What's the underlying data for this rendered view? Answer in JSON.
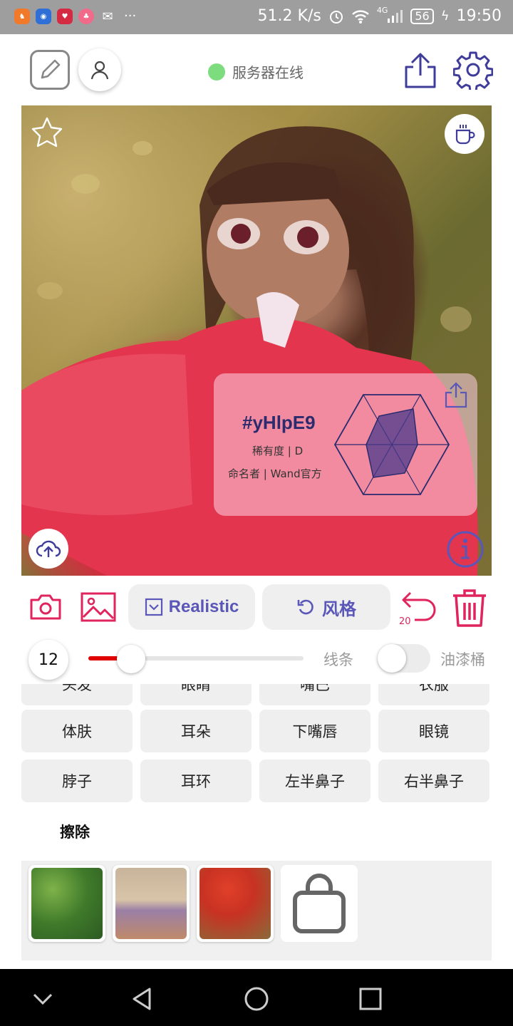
{
  "status_bar": {
    "net_speed": "51.2 K/s",
    "signal_label": "4G",
    "battery": "56",
    "time": "19:50",
    "apps": [
      {
        "icon": "game-app-icon",
        "color": "#f07a2a"
      },
      {
        "icon": "browser-app-icon",
        "color": "#2f6fd6"
      },
      {
        "icon": "heart-app-icon",
        "color": "#d42b43"
      },
      {
        "icon": "lolo-app-icon",
        "color": "#f26a8a"
      },
      {
        "icon": "wechat-icon",
        "color": "#9e9e9e"
      }
    ],
    "more": "···"
  },
  "top_bar": {
    "server_status": "服务器在线",
    "server_color": "#7ddc7d"
  },
  "card": {
    "id": "#yHlpE9",
    "rarity": "稀有度 | D",
    "namer": "命名者 | Wand官方"
  },
  "toolbar": {
    "style_label": "Realistic",
    "fengge_label": "风格",
    "undo_count": "20",
    "accent_color": "#e0245e",
    "brand_color": "#5a57b8"
  },
  "slider": {
    "size_value": "12",
    "level_fraction": 0.2,
    "line_label": "线条",
    "bucket_label": "油漆桶",
    "bucket_enabled": false
  },
  "parts": {
    "partial_row": [
      "头发",
      "眼睛",
      "嘴巴",
      "衣服"
    ],
    "rows": [
      [
        "体肤",
        "耳朵",
        "下嘴唇",
        "眼镜"
      ],
      [
        "脖子",
        "耳环",
        "左半鼻子",
        "右半鼻子"
      ]
    ],
    "erase_label": "擦除"
  },
  "thumbnails": [
    {
      "name": "thumb-green-bush"
    },
    {
      "name": "thumb-purple-flowers"
    },
    {
      "name": "thumb-red-flowers"
    }
  ]
}
